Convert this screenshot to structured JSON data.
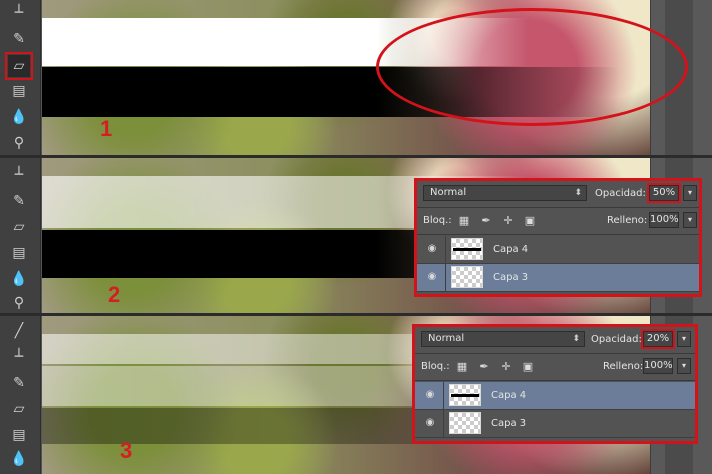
{
  "panels": [
    {
      "step": "1"
    },
    {
      "step": "2"
    },
    {
      "step": "3"
    }
  ],
  "layers_panels": [
    {
      "blend_mode": "Normal",
      "opacity_label": "Opacidad:",
      "opacity_value": "50%",
      "lock_label": "Bloq.:",
      "fill_label": "Relleno:",
      "fill_value": "100%",
      "layers": [
        {
          "name": "Capa 4",
          "selected": false
        },
        {
          "name": "Capa 3",
          "selected": true
        }
      ]
    },
    {
      "blend_mode": "Normal",
      "opacity_label": "Opacidad:",
      "opacity_value": "20%",
      "lock_label": "Bloq.:",
      "fill_label": "Relleno:",
      "fill_value": "100%",
      "layers": [
        {
          "name": "Capa 4",
          "selected": true
        },
        {
          "name": "Capa 3",
          "selected": false
        }
      ]
    }
  ],
  "tools": [
    "clone-stamp-icon",
    "history-brush-icon",
    "eraser-icon",
    "gradient-icon",
    "blur-icon",
    "dodge-icon"
  ],
  "colors": {
    "highlight": "#d4121a",
    "selected_layer": "#6b7d99",
    "panel_bg": "#535353"
  }
}
